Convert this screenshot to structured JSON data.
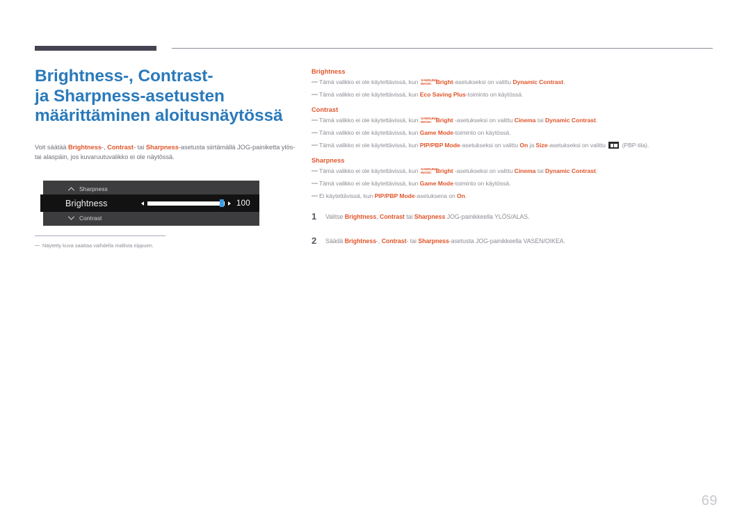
{
  "header": {
    "rule_color": "#474353",
    "thin_rule_color": "#8e8a99"
  },
  "left": {
    "title_line1": "Brightness-, Contrast-",
    "title_line2": "ja Sharpness-asetusten",
    "title_line3": "määrittäminen aloitusnäytössä",
    "title_color": "#2a7abb",
    "intro": {
      "t1": "Voit säätää ",
      "k1": "Brightness",
      "t2": "-, ",
      "k2": "Contrast",
      "t3": "- tai ",
      "k3": "Sharpness",
      "t4": "-asetusta siirtämällä JOG-painiketta ylös- tai alaspäin, jos kuvaruutuvalikko ei ole näytössä."
    }
  },
  "osd": {
    "row_top_label": "Sharpness",
    "row_top_icon": "chevron-up-icon",
    "active_label": "Brightness",
    "slider_value": "100",
    "slider_percent": 96,
    "row_bottom_label": "Contrast",
    "row_bottom_icon": "chevron-down-icon",
    "panel_color": "#3d3d3f",
    "active_color": "#121212",
    "knob_color": "#3e9be0"
  },
  "footnote": {
    "text": "Näytetty kuva saattaa vaihdella mallista riippuen."
  },
  "right": {
    "accent_color": "#e0552b",
    "sections": [
      {
        "heading": "Brightness",
        "notes": [
          {
            "parts": [
              {
                "t": "Tämä valikko ei ole käytettävissä, kun ",
                "s": "plain"
              },
              {
                "t": "SAMSUNGMAGIC",
                "s": "smagic"
              },
              {
                "t": "Bright",
                "s": "bold"
              },
              {
                "t": "-asetukseksi on valittu ",
                "s": "plain"
              },
              {
                "t": "Dynamic Contrast",
                "s": "bold"
              },
              {
                "t": ".",
                "s": "plain"
              }
            ]
          },
          {
            "parts": [
              {
                "t": "Tämä valikko ei ole käytettävissä, kun ",
                "s": "plain"
              },
              {
                "t": "Eco Saving Plus",
                "s": "bold"
              },
              {
                "t": "-toiminto on käytössä.",
                "s": "plain"
              }
            ]
          }
        ]
      },
      {
        "heading": "Contrast",
        "notes": [
          {
            "parts": [
              {
                "t": "Tämä valikko ei ole käytettävissä, kun ",
                "s": "plain"
              },
              {
                "t": "SAMSUNGMAGIC",
                "s": "smagic"
              },
              {
                "t": "Bright",
                "s": "bold"
              },
              {
                "t": " -asetukseksi on valittu ",
                "s": "plain"
              },
              {
                "t": "Cinema",
                "s": "bold"
              },
              {
                "t": " tai ",
                "s": "plain"
              },
              {
                "t": "Dynamic Contrast",
                "s": "bold"
              },
              {
                "t": ".",
                "s": "plain"
              }
            ]
          },
          {
            "parts": [
              {
                "t": "Tämä valikko ei ole käytettävissä, kun ",
                "s": "plain"
              },
              {
                "t": "Game Mode",
                "s": "bold"
              },
              {
                "t": "-toiminto on käytössä.",
                "s": "plain"
              }
            ]
          },
          {
            "parts": [
              {
                "t": "Tämä valikko ei ole käytettävissä, kun ",
                "s": "plain"
              },
              {
                "t": "PIP/PBP Mode",
                "s": "bold"
              },
              {
                "t": "-asetukseksi on valittu ",
                "s": "plain"
              },
              {
                "t": "On",
                "s": "bold"
              },
              {
                "t": " ja ",
                "s": "plain"
              },
              {
                "t": "Size",
                "s": "bold"
              },
              {
                "t": "-asetukseksi on valittu ",
                "s": "plain"
              },
              {
                "t": "pbp-icon",
                "s": "icon"
              },
              {
                "t": " (PBP-tila).",
                "s": "plain"
              }
            ]
          }
        ]
      },
      {
        "heading": "Sharpness",
        "notes": [
          {
            "parts": [
              {
                "t": "Tämä valikko ei ole käytettävissä, kun ",
                "s": "plain"
              },
              {
                "t": "SAMSUNGMAGIC",
                "s": "smagic"
              },
              {
                "t": "Bright",
                "s": "bold"
              },
              {
                "t": " -asetukseksi on valittu ",
                "s": "plain"
              },
              {
                "t": "Cinema",
                "s": "bold"
              },
              {
                "t": " tai ",
                "s": "plain"
              },
              {
                "t": "Dynamic Contrast",
                "s": "bold"
              },
              {
                "t": ".",
                "s": "plain"
              }
            ]
          },
          {
            "parts": [
              {
                "t": "Tämä valikko ei ole käytettävissä, kun ",
                "s": "plain"
              },
              {
                "t": "Game Mode",
                "s": "bold"
              },
              {
                "t": "-toiminto on käytössä.",
                "s": "plain"
              }
            ]
          },
          {
            "parts": [
              {
                "t": "Ei käytettävissä, kun ",
                "s": "plain"
              },
              {
                "t": "PIP/PBP Mode",
                "s": "bold"
              },
              {
                "t": "-asetuksena on ",
                "s": "plain"
              },
              {
                "t": "On",
                "s": "bold"
              },
              {
                "t": ".",
                "s": "plain"
              }
            ]
          }
        ]
      }
    ],
    "steps": [
      {
        "num": "1",
        "parts": [
          {
            "t": "Valitse ",
            "s": "plain"
          },
          {
            "t": "Brightness",
            "s": "bold"
          },
          {
            "t": ", ",
            "s": "plain"
          },
          {
            "t": "Contrast",
            "s": "bold"
          },
          {
            "t": " tai ",
            "s": "plain"
          },
          {
            "t": "Sharpness",
            "s": "bold"
          },
          {
            "t": " JOG-painikkeella YLÖS/ALAS.",
            "s": "plain"
          }
        ]
      },
      {
        "num": "2",
        "parts": [
          {
            "t": "Säädä ",
            "s": "plain"
          },
          {
            "t": "Brightness",
            "s": "bold"
          },
          {
            "t": "-, ",
            "s": "plain"
          },
          {
            "t": "Contrast",
            "s": "bold"
          },
          {
            "t": "- tai ",
            "s": "plain"
          },
          {
            "t": "Sharpness",
            "s": "bold"
          },
          {
            "t": "-asetusta JOG-painikkeella VASEN/OIKEA.",
            "s": "plain"
          }
        ]
      }
    ]
  },
  "page_number": "69"
}
